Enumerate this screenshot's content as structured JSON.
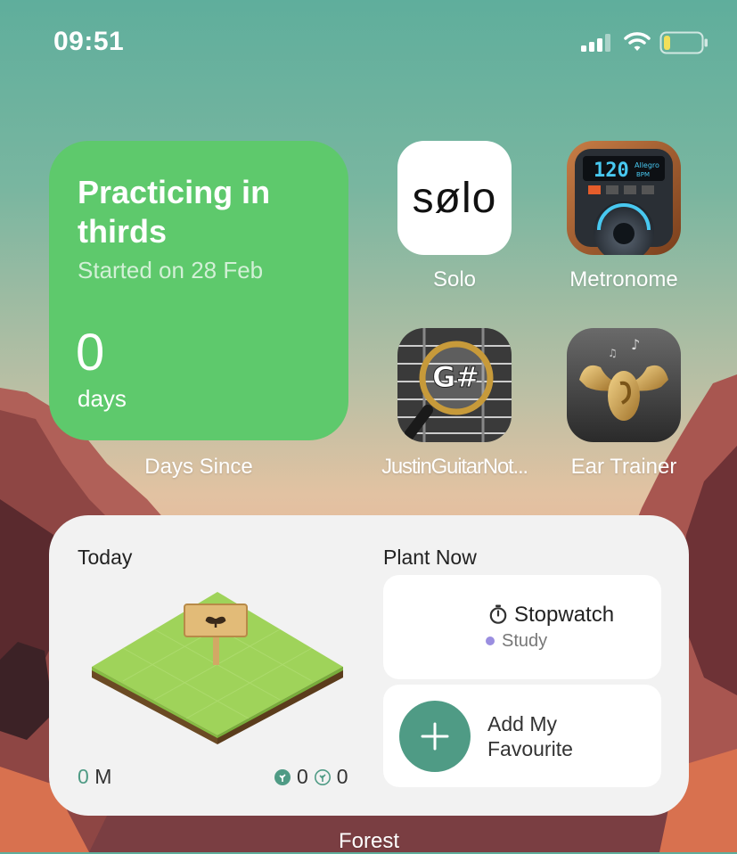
{
  "status_bar": {
    "time": "09:51"
  },
  "days_widget": {
    "title": "Practicing in thirds",
    "subtitle": "Started on 28 Feb",
    "count": "0",
    "unit": "days",
    "label": "Days Since"
  },
  "apps": [
    {
      "name": "Solo",
      "icon_text": "søl​o"
    },
    {
      "name": "Metronome",
      "icon_text": "120 Allegro BPM"
    },
    {
      "name": "JustinGuitarNot...",
      "icon_text": "G#"
    },
    {
      "name": "Ear Trainer"
    }
  ],
  "forest_widget": {
    "today_label": "Today",
    "plant_now_label": "Plant Now",
    "stopwatch_title": "Stopwatch",
    "stopwatch_tag": "Study",
    "add_favourite": "Add My Favourite",
    "minutes_value": "0",
    "minutes_unit": "M",
    "healthy_count": "0",
    "dead_count": "0",
    "label": "Forest"
  },
  "colors": {
    "days_widget_bg": "#5ec96c",
    "forest_accent": "#4f9b85",
    "study_tag": "#9a8ee0"
  }
}
